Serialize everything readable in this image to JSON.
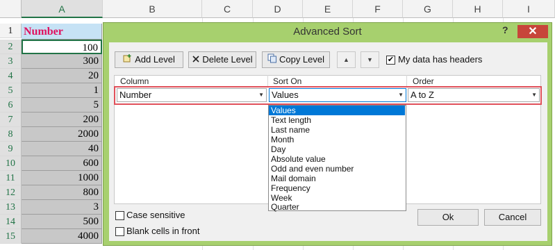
{
  "sheet": {
    "columns": [
      "A",
      "B",
      "C",
      "D",
      "E",
      "F",
      "G",
      "H",
      "I"
    ],
    "rows": [
      "1",
      "2",
      "3",
      "4",
      "5",
      "6",
      "7",
      "8",
      "9",
      "10",
      "11",
      "12",
      "13",
      "14",
      "15"
    ],
    "column_a": [
      "Number",
      "100",
      "300",
      "20",
      "1",
      "5",
      "200",
      "2000",
      "40",
      "600",
      "1000",
      "800",
      "3",
      "500",
      "4000"
    ]
  },
  "dialog": {
    "title": "Advanced Sort",
    "help": "?",
    "close": "✕",
    "toolbar": {
      "add_level": "Add Level",
      "delete_level": "Delete Level",
      "copy_level": "Copy Level",
      "up": "▲",
      "down": "▼",
      "my_data_has_headers": "My data has headers",
      "headers_checked": "✔"
    },
    "columns": {
      "column": "Column",
      "sort_on": "Sort On",
      "order": "Order"
    },
    "level": {
      "column": "Number",
      "sort_on": "Values",
      "order": "A to Z",
      "arrow": "▼"
    },
    "sort_on_options": [
      "Values",
      "Text length",
      "Last name",
      "Month",
      "Day",
      "Absolute value",
      "Odd and even number",
      "Mail domain",
      "Frequency",
      "Week",
      "Quarter"
    ],
    "case_sensitive": "Case sensitive",
    "blank_cells_in_front": "Blank cells in front",
    "ok": "Ok",
    "cancel": "Cancel"
  }
}
